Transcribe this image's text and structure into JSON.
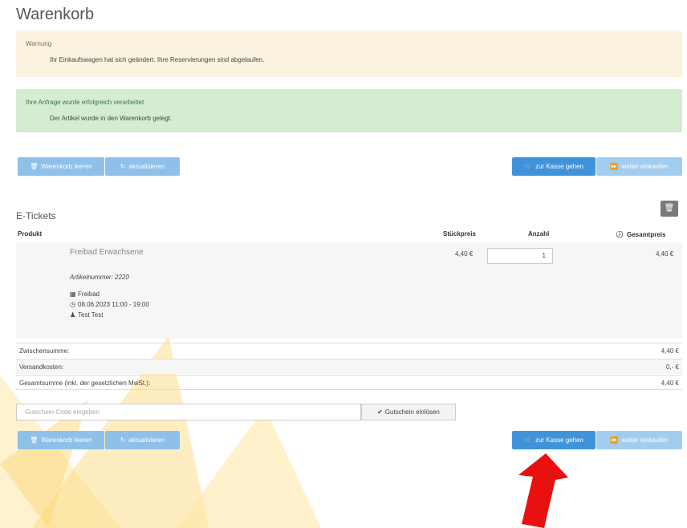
{
  "page": {
    "title": "Warenkorb"
  },
  "alerts": {
    "warning": {
      "title": "Warnung",
      "message": "Ihr Einkaufswagen hat sich geändert. Ihre Reservierungen sind abgelaufen."
    },
    "success": {
      "title": "Ihre Anfrage wurde erfolgreich verarbeitet",
      "message": "Der Artikel wurde in den Warenkorb gelegt."
    }
  },
  "actions": {
    "clear_cart": "Warenkorb leeren",
    "update": "aktualisieren",
    "checkout": "zur Kasse gehen",
    "continue_shopping": "weiter einkaufen"
  },
  "section": {
    "title": "E-Tickets"
  },
  "table": {
    "headers": {
      "product": "Produkt",
      "unit_price": "Stückpreis",
      "quantity": "Anzahl",
      "total": "Gesamtpreis"
    }
  },
  "item": {
    "name": "Freibad Erwachsene",
    "article_number": "Artikelnummer: 2220",
    "venue": "Freibad",
    "datetime": "08.06.2023 11:00 - 19:00",
    "person": "Test Test",
    "unit_price": "4,40 €",
    "quantity": "1",
    "total": "4,40 €"
  },
  "summary": [
    {
      "label": "Zwischensumme:",
      "value": "4,40 €"
    },
    {
      "label": "Versandkosten:",
      "value": "0,- €"
    },
    {
      "label": "Gesamtsumme (inkl. der gesetzlichen MwSt.):",
      "value": "4,40 €"
    }
  ],
  "voucher": {
    "placeholder": "Gutschein-Code eingeben",
    "button": "Gutschein einlösen"
  },
  "icons": {
    "clear": "trash-icon",
    "update": "refresh-icon",
    "checkout": "cart-icon",
    "continue": "forward-icon",
    "delete": "trash-icon",
    "info": "info-icon",
    "venue": "building-icon",
    "time": "clock-icon",
    "person": "user-icon",
    "check": "check-icon",
    "annotation": "red-arrow-icon"
  },
  "colors": {
    "primary": "#3f93d8",
    "primary_light": "#8ec0ea",
    "warning_bg": "#fbf3df",
    "success_bg": "#d5ecd2",
    "annotation_red": "#e8110f"
  }
}
